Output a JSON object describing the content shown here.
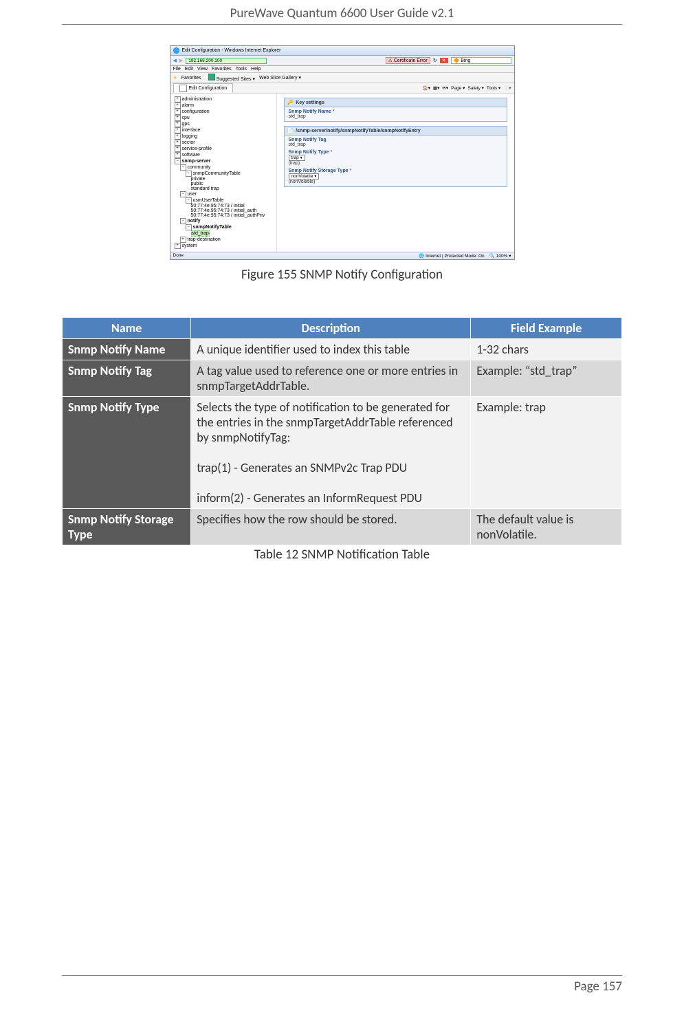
{
  "header": {
    "title": "PureWave Quantum 6600 User Guide v2.1"
  },
  "footer": {
    "page": "Page 157"
  },
  "figure_caption": "Figure 155 SNMP Notify Configuration",
  "table_caption": "Table 12 SNMP Notification Table",
  "screenshot": {
    "window_title": "Edit Configuration - Windows Internet Explorer",
    "menubar": [
      "File",
      "Edit",
      "View",
      "Favorites",
      "Tools",
      "Help"
    ],
    "favorites_label": "Favorites",
    "suggested_sites": "Suggested Sites ▾",
    "web_slice": "Web Slice Gallery ▾",
    "tab": "Edit Configuration",
    "cert": "Certificate Error",
    "search_engine": "Bing",
    "toolbar_right": [
      "Page ▾",
      "Safety ▾",
      "Tools ▾"
    ],
    "tree": [
      "administration",
      "alarm",
      "configuration",
      "cpu",
      "gps",
      "interface",
      "logging",
      "sector",
      "service-profile",
      "software"
    ],
    "tree_snmp": "snmp-server",
    "tree_sub": {
      "community": "community",
      "communityTable": "snmpCommunityTable",
      "community_children": [
        "private",
        "public",
        "standard trap"
      ],
      "user": "user",
      "usmUserTable": "usmUserTable",
      "usm_children": [
        "50:77:4e:95:74:73 / initial",
        "50:77:4e:95:74:73 / initial_auth",
        "50:77:4e:95:74:73 / initial_authPriv"
      ],
      "notify": "notify",
      "snmpNotifyTable": "snmpNotifyTable",
      "std_trap": "std_trap",
      "trap_dest": "trap-destination"
    },
    "tree_system": "system",
    "panel": {
      "key_settings": "Key settings",
      "name_label": "Snmp Notify Name",
      "name_value": "std_trap",
      "path": "/snmp-server/notify/snmpNotifyTable/snmpNotifyEntry",
      "tag_label": "Snmp Notify Tag",
      "tag_value": "std_trap",
      "type_label": "Snmp Notify Type",
      "type_select": "trap",
      "type_help": "(trap)",
      "storage_label": "Snmp Notify Storage Type",
      "storage_select": "nonVolatile",
      "storage_help": "(nonVolatile)"
    },
    "status": {
      "left": "Done",
      "mode": "Internet | Protected Mode: On",
      "zoom": "100%"
    }
  },
  "table": {
    "headers": [
      "Name",
      "Description",
      "Field Example"
    ],
    "rows": [
      {
        "name": "Snmp Notify Name",
        "desc": "A unique identifier used to index this table",
        "example": "1-32 chars"
      },
      {
        "name": "Snmp Notify Tag",
        "desc": "A tag value used to reference one or more entries in snmpTargetAddrTable.",
        "example": "Example: “std_trap”"
      },
      {
        "name": "Snmp Notify Type",
        "desc": "Selects the type of notification to be generated for the entries in the snmpTargetAddrTable referenced by snmpNotifyTag:\n\ntrap(1) - Generates an SNMPv2c Trap PDU\n\ninform(2) - Generates an InformRequest PDU",
        "example": "Example: trap"
      },
      {
        "name": "Snmp Notify Storage Type",
        "desc": "Specifies how the row should be stored.",
        "example": "The default value is nonVolatile."
      }
    ]
  }
}
